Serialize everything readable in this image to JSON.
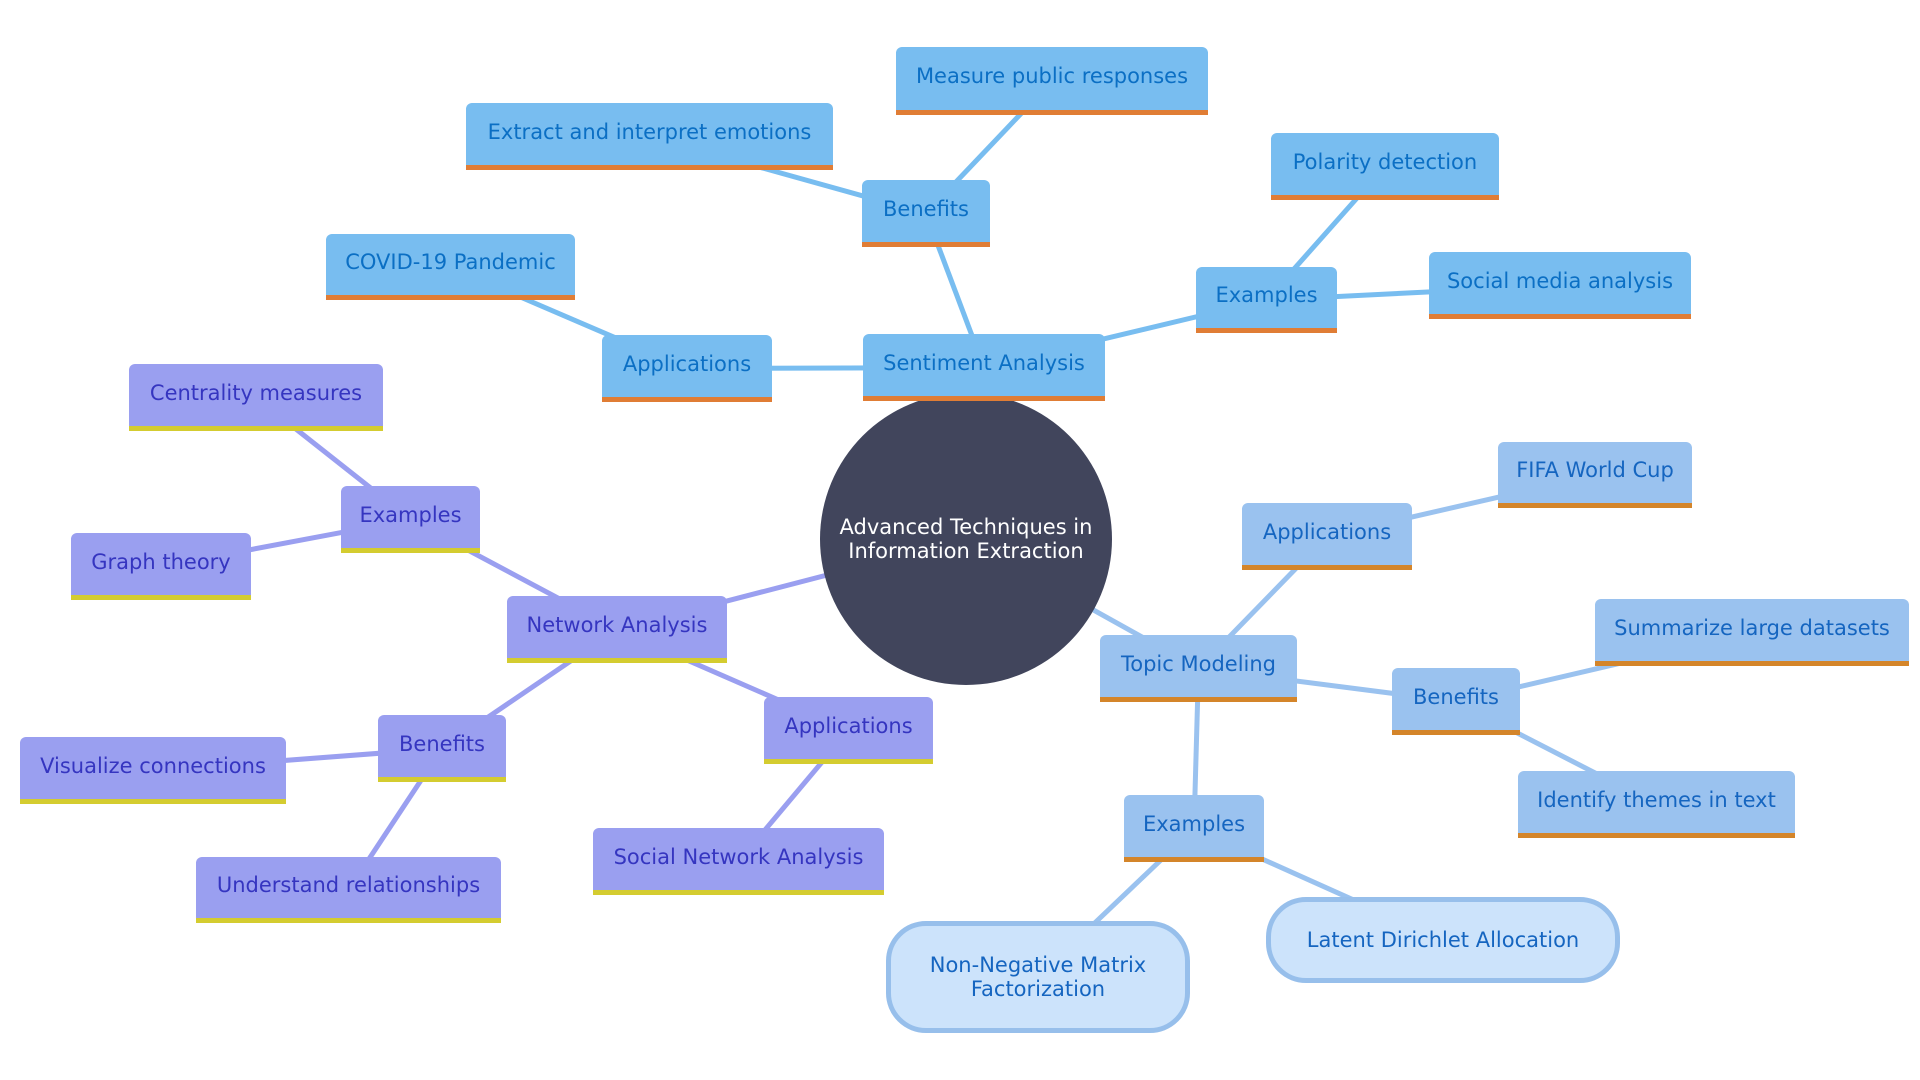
{
  "colors": {
    "sentiment_edge": "#78bdf0",
    "network_edge": "#9a9ff0",
    "topic_edge": "#9ac2ef"
  },
  "root": {
    "label": "Advanced Techniques in Information Extraction"
  },
  "sentiment": {
    "label": "Sentiment Analysis",
    "applications": {
      "label": "Applications",
      "items": [
        "COVID-19 Pandemic"
      ]
    },
    "benefits": {
      "label": "Benefits",
      "items": [
        "Extract and interpret emotions",
        "Measure public responses"
      ]
    },
    "examples": {
      "label": "Examples",
      "items": [
        "Polarity detection",
        "Social media analysis"
      ]
    }
  },
  "network": {
    "label": "Network Analysis",
    "examples": {
      "label": "Examples",
      "items": [
        "Centrality measures",
        "Graph theory"
      ]
    },
    "benefits": {
      "label": "Benefits",
      "items": [
        "Visualize connections",
        "Understand relationships"
      ]
    },
    "applications": {
      "label": "Applications",
      "items": [
        "Social Network Analysis"
      ]
    }
  },
  "topic": {
    "label": "Topic Modeling",
    "applications": {
      "label": "Applications",
      "items": [
        "FIFA World Cup"
      ]
    },
    "benefits": {
      "label": "Benefits",
      "items": [
        "Summarize large datasets",
        "Identify themes in text"
      ]
    },
    "examples": {
      "label": "Examples",
      "items": [
        "Latent Dirichlet Allocation",
        "Non-Negative Matrix Factorization"
      ]
    }
  }
}
